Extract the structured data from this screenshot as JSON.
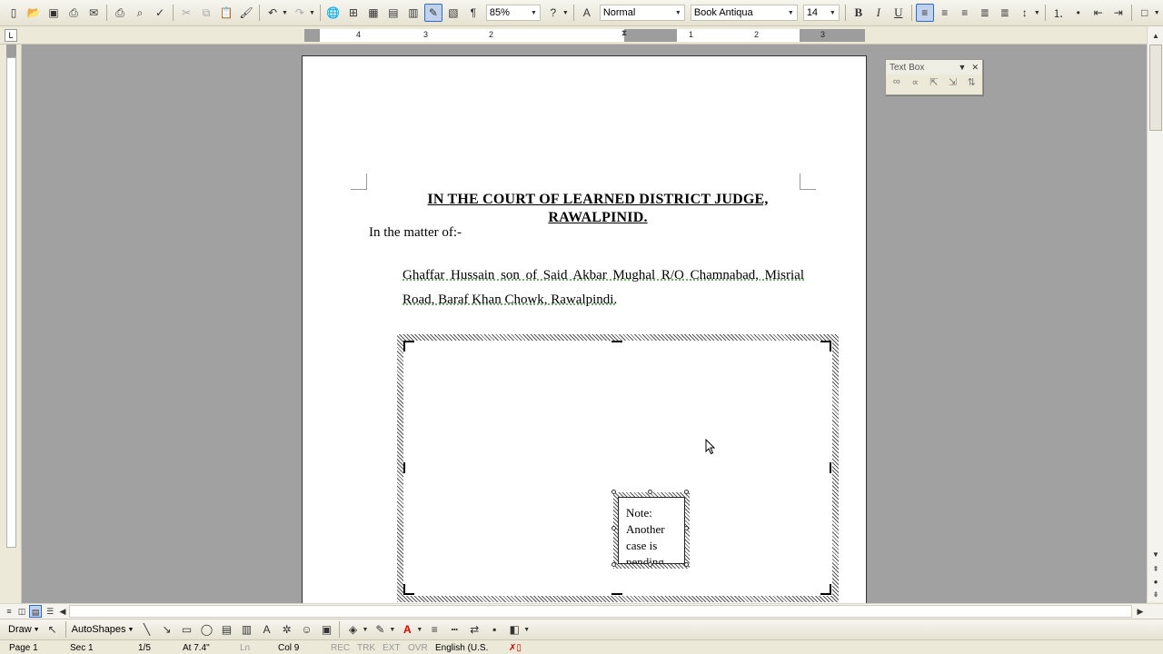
{
  "toolbar": {
    "zoom": "85%",
    "style": "Normal",
    "font": "Book Antiqua",
    "font_size": "14",
    "paragraph_mark": "¶"
  },
  "ruler": {
    "numbers_left": [
      "4",
      "3",
      "2"
    ],
    "numbers_right": [
      "1",
      "2",
      "3"
    ]
  },
  "document": {
    "title": "IN THE COURT OF LEARNED DISTRICT JUDGE, RAWALPINID.",
    "matter": "In the matter of:-",
    "party": "Ghaffar Hussain son of Said Akbar Mughal R/O Chamnabad, Misrial Road, Baraf Khan Chowk, Rawalpindi.",
    "note": "Note: Another case is pending"
  },
  "textbox_toolbar": {
    "title": "Text Box"
  },
  "drawbar": {
    "draw_label": "Draw",
    "autoshapes_label": "AutoShapes"
  },
  "statusbar": {
    "page": "Page 1",
    "section": "Sec 1",
    "page_of": "1/5",
    "at": "At 7.4\"",
    "ln": "Ln",
    "col": "Col 9",
    "rec": "REC",
    "trk": "TRK",
    "ext": "EXT",
    "ovr": "OVR",
    "language": "English (U.S."
  },
  "colors": {
    "workspace": "#a1a1a1",
    "chrome": "#ece9d8",
    "active_button": "#c1d2ee",
    "font_color_bar": "#e00000",
    "grammar_underline": "#3a9a3a"
  }
}
